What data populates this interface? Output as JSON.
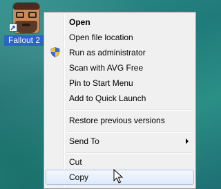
{
  "desktop": {
    "icon_label": "Fallout 2"
  },
  "menu": {
    "items": [
      {
        "label": "Open"
      },
      {
        "label": "Open file location"
      },
      {
        "label": "Run as administrator"
      },
      {
        "label": "Scan with AVG Free"
      },
      {
        "label": "Pin to Start Menu"
      },
      {
        "label": "Add to Quick Launch"
      },
      {
        "label": "Restore previous versions"
      },
      {
        "label": "Send To"
      },
      {
        "label": "Cut"
      },
      {
        "label": "Copy"
      }
    ]
  },
  "colors": {
    "desktop_bg": "#1f7a7a",
    "menu_bg": "#f0f0f0",
    "hover_border": "#a8c3e3",
    "label_highlight": "#2c63c4"
  },
  "icons": {
    "shield": "uac-shield-icon",
    "submenu": "chevron-right-icon",
    "cursor": "mouse-pointer-icon",
    "shortcut": "shortcut-arrow-icon"
  }
}
